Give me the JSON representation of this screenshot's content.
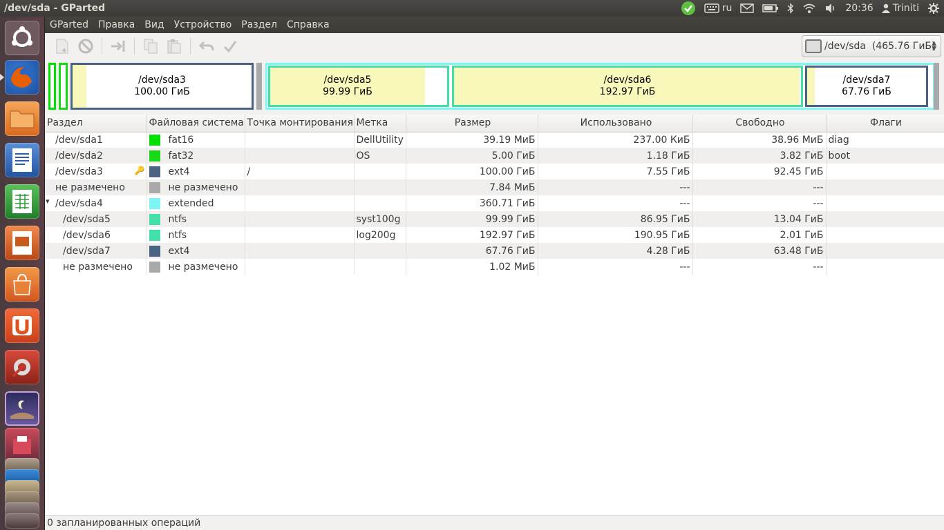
{
  "window_title": "/dev/sda - GParted",
  "tray": {
    "keyboard_layout": "ru",
    "time": "20:36",
    "user": "Triniti"
  },
  "launcher": [
    {
      "name": "ubuntu-dash",
      "color": "#7a6b6f"
    },
    {
      "name": "firefox",
      "color": "#e66000"
    },
    {
      "name": "files",
      "color": "#e8823a"
    },
    {
      "name": "writer",
      "color": "#2a5fa8"
    },
    {
      "name": "calc",
      "color": "#2f9a3a"
    },
    {
      "name": "impress",
      "color": "#c85a1e"
    },
    {
      "name": "software-center",
      "color": "#e06a2a"
    },
    {
      "name": "ubuntu-one",
      "color": "#dd5420"
    },
    {
      "name": "system-settings",
      "color": "#c43a2e"
    },
    {
      "name": "gparted",
      "color": "#3a3a6a"
    }
  ],
  "menu": [
    "GParted",
    "Правка",
    "Вид",
    "Устройство",
    "Раздел",
    "Справка"
  ],
  "device_selector": "/dev/sda  (465.76 ГиБ)",
  "diskmap": {
    "sda3": {
      "name": "/dev/sda3",
      "size": "100.00 ГиБ"
    },
    "sda5": {
      "name": "/dev/sda5",
      "size": "99.99 ГиБ"
    },
    "sda6": {
      "name": "/dev/sda6",
      "size": "192.97 ГиБ"
    },
    "sda7": {
      "name": "/dev/sda7",
      "size": "67.76 ГиБ"
    }
  },
  "columns": [
    "Раздел",
    "Файловая система",
    "Точка монтирования",
    "Метка",
    "Размер",
    "Использовано",
    "Свободно",
    "Флаги"
  ],
  "rows": [
    {
      "part": "/dev/sda1",
      "indent": 0,
      "expander": "",
      "fs": "fat16",
      "color": "#00e000",
      "mount": "",
      "label": "DellUtility",
      "size": "39.19 МиБ",
      "used": "237.00 КиБ",
      "free": "38.96 МиБ",
      "flags": "diag",
      "locked": false
    },
    {
      "part": "/dev/sda2",
      "indent": 0,
      "expander": "",
      "fs": "fat32",
      "color": "#18d818",
      "mount": "",
      "label": "OS",
      "size": "5.00 ГиБ",
      "used": "1.18 ГиБ",
      "free": "3.82 ГиБ",
      "flags": "boot",
      "locked": false
    },
    {
      "part": "/dev/sda3",
      "indent": 0,
      "expander": "",
      "fs": "ext4",
      "color": "#4a6283",
      "mount": "/",
      "label": "",
      "size": "100.00 ГиБ",
      "used": "7.55 ГиБ",
      "free": "92.45 ГиБ",
      "flags": "",
      "locked": true
    },
    {
      "part": "не размечено",
      "indent": 0,
      "expander": "",
      "fs": "не размечено",
      "color": "#a9a9a9",
      "mount": "",
      "label": "",
      "size": "7.84 МиБ",
      "used": "---",
      "free": "---",
      "flags": "",
      "locked": false
    },
    {
      "part": "/dev/sda4",
      "indent": 0,
      "expander": "▾",
      "fs": "extended",
      "color": "#7cf5f5",
      "mount": "",
      "label": "",
      "size": "360.71 ГиБ",
      "used": "---",
      "free": "---",
      "flags": "",
      "locked": false
    },
    {
      "part": "/dev/sda5",
      "indent": 1,
      "expander": "",
      "fs": "ntfs",
      "color": "#44dfa8",
      "mount": "",
      "label": "syst100g",
      "size": "99.99 ГиБ",
      "used": "86.95 ГиБ",
      "free": "13.04 ГиБ",
      "flags": "",
      "locked": false
    },
    {
      "part": "/dev/sda6",
      "indent": 1,
      "expander": "",
      "fs": "ntfs",
      "color": "#44dfa8",
      "mount": "",
      "label": "log200g",
      "size": "192.97 ГиБ",
      "used": "190.95 ГиБ",
      "free": "2.01 ГиБ",
      "flags": "",
      "locked": false
    },
    {
      "part": "/dev/sda7",
      "indent": 1,
      "expander": "",
      "fs": "ext4",
      "color": "#4a6283",
      "mount": "",
      "label": "",
      "size": "67.76 ГиБ",
      "used": "4.28 ГиБ",
      "free": "63.48 ГиБ",
      "flags": "",
      "locked": false
    },
    {
      "part": "не размечено",
      "indent": 1,
      "expander": "",
      "fs": "не размечено",
      "color": "#a9a9a9",
      "mount": "",
      "label": "",
      "size": "1.02 МиБ",
      "used": "---",
      "free": "---",
      "flags": "",
      "locked": false
    }
  ],
  "status": "0 запланированных операций",
  "colors": {
    "accent_ext4": "#4a6283",
    "accent_ntfs": "#44dfa8",
    "accent_extended": "#7cf5f5",
    "accent_fat": "#00e000",
    "used_space": "#f8f8ba"
  }
}
